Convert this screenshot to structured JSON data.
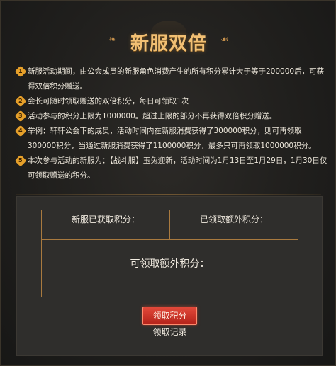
{
  "page": {
    "title": "新服双倍"
  },
  "rules": [
    {
      "num": "1",
      "text": "新服活动期间，由公会成员的新服角色消费产生的所有积分累计大于等于200000后，可获得双倍积分赠送。"
    },
    {
      "num": "2",
      "text": "会长可随时领取赠送的双倍积分，每日可领取1次"
    },
    {
      "num": "3",
      "text": "活动参与的积分上限为1000000。超过上限的部分不再获得双倍积分赠送。"
    },
    {
      "num": "4",
      "text": "举例：轩轩公会下的成员，活动时间内在新服消费获得了300000积分，则可再领取300000积分，当通过新服消费获得了1100000积分，最多只可再领取1000000积分。"
    },
    {
      "num": "5",
      "text": "本次参与活动的新服为：【战斗服】玉兔迎新，活动时间为1月13日至1月29日，1月30日仅可领取赠送的积分。"
    }
  ],
  "table": {
    "obtained_label": "新服已获取积分：",
    "claimed_label": "已领取额外积分：",
    "claimable_label": "可领取额外积分："
  },
  "actions": {
    "claim_label": "领取积分",
    "record_label": "领取记录"
  },
  "colors": {
    "title": "#f2c074",
    "accent_border": "#a97a3f",
    "number_badge": "#e6a02a",
    "claim_button": "#c9342a"
  }
}
